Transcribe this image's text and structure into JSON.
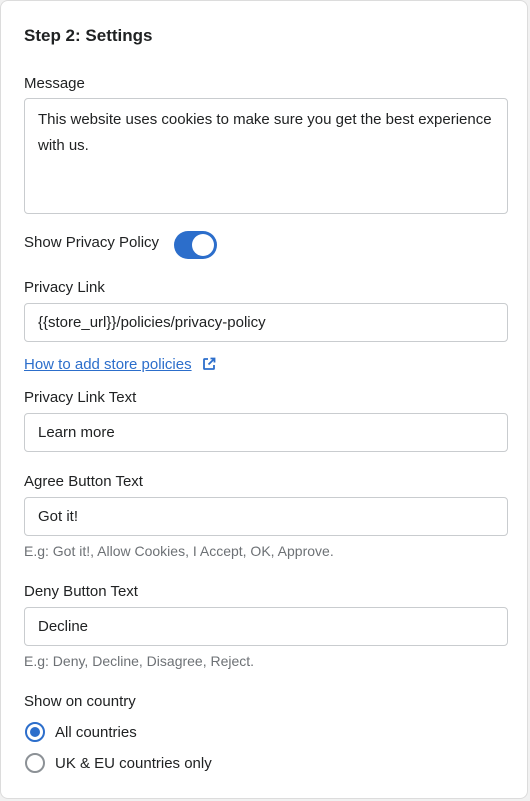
{
  "section": {
    "title": "Step 2: Settings"
  },
  "message": {
    "label": "Message",
    "value": "This website uses cookies to make sure you get the best experience with us."
  },
  "privacy_policy": {
    "toggle_label": "Show Privacy Policy",
    "enabled": true
  },
  "privacy_link": {
    "label": "Privacy Link",
    "value": "{{store_url}}/policies/privacy-policy"
  },
  "help_link": {
    "text": "How to add store policies",
    "icon": "external-link-icon"
  },
  "privacy_link_text": {
    "label": "Privacy Link Text",
    "value": "Learn more"
  },
  "agree_button_text": {
    "label": "Agree Button Text",
    "value": "Got it!",
    "help": "E.g: Got it!, Allow Cookies, I Accept, OK, Approve."
  },
  "deny_button_text": {
    "label": "Deny Button Text",
    "value": "Decline",
    "help": "E.g: Deny, Decline, Disagree, Reject."
  },
  "show_on_country": {
    "label": "Show on country",
    "options": [
      {
        "label": "All countries",
        "selected": true
      },
      {
        "label": "UK & EU countries only",
        "selected": false
      }
    ]
  },
  "colors": {
    "accent": "#2c6ecb",
    "text": "#202223",
    "muted": "#6d7175",
    "border": "#c9cccf"
  }
}
